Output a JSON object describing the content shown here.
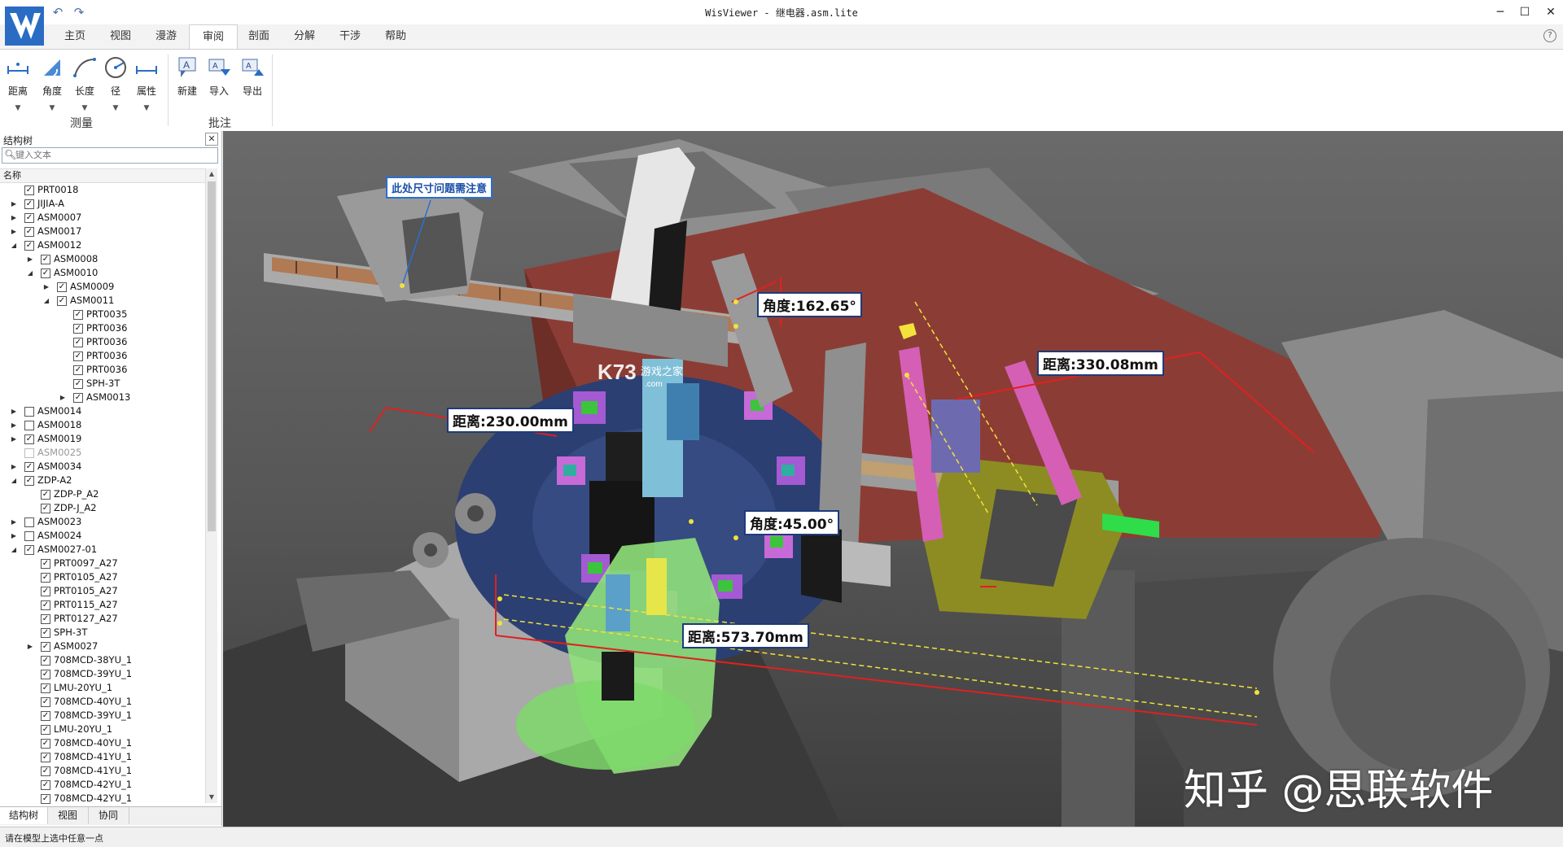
{
  "window": {
    "title": "WisViewer - 继电器.asm.lite"
  },
  "tabs": [
    {
      "label": "主页"
    },
    {
      "label": "视图"
    },
    {
      "label": "漫游"
    },
    {
      "label": "审阅",
      "active": true
    },
    {
      "label": "剖面"
    },
    {
      "label": "分解"
    },
    {
      "label": "干涉"
    },
    {
      "label": "帮助"
    }
  ],
  "ribbon": {
    "measure": {
      "group_label": "测量",
      "buttons": [
        {
          "label": "距离",
          "icon": "distance-icon"
        },
        {
          "label": "角度",
          "icon": "angle-icon"
        },
        {
          "label": "长度",
          "icon": "length-icon"
        },
        {
          "label": "径",
          "icon": "radius-icon"
        },
        {
          "label": "属性",
          "icon": "property-icon"
        }
      ]
    },
    "annotate": {
      "group_label": "批注",
      "buttons": [
        {
          "label": "新建",
          "icon": "new-annotation-icon"
        },
        {
          "label": "导入",
          "icon": "import-icon"
        },
        {
          "label": "导出",
          "icon": "export-icon"
        }
      ]
    }
  },
  "panel": {
    "title": "结构树",
    "search_placeholder": "键入文本",
    "column_header": "名称",
    "tabs": [
      "结构树",
      "视图",
      "协同"
    ]
  },
  "tree": [
    {
      "name": "PRT0018",
      "d": 1,
      "t": "",
      "c": "on"
    },
    {
      "name": "JIJIA-A",
      "d": 1,
      "t": "c",
      "c": "on"
    },
    {
      "name": "ASM0007",
      "d": 1,
      "t": "c",
      "c": "on"
    },
    {
      "name": "ASM0017",
      "d": 1,
      "t": "c",
      "c": "on"
    },
    {
      "name": "ASM0012",
      "d": 1,
      "t": "e",
      "c": "on"
    },
    {
      "name": "ASM0008",
      "d": 2,
      "t": "c",
      "c": "on"
    },
    {
      "name": "ASM0010",
      "d": 2,
      "t": "e",
      "c": "on"
    },
    {
      "name": "ASM0009",
      "d": 3,
      "t": "c",
      "c": "on"
    },
    {
      "name": "ASM0011",
      "d": 3,
      "t": "e",
      "c": "on"
    },
    {
      "name": "PRT0035",
      "d": 4,
      "t": "",
      "c": "on"
    },
    {
      "name": "PRT0036",
      "d": 4,
      "t": "",
      "c": "on"
    },
    {
      "name": "PRT0036",
      "d": 4,
      "t": "",
      "c": "on"
    },
    {
      "name": "PRT0036",
      "d": 4,
      "t": "",
      "c": "on"
    },
    {
      "name": "PRT0036",
      "d": 4,
      "t": "",
      "c": "on"
    },
    {
      "name": "SPH-3T",
      "d": 4,
      "t": "",
      "c": "on"
    },
    {
      "name": "ASM0013",
      "d": 4,
      "t": "c",
      "c": "on"
    },
    {
      "name": "ASM0014",
      "d": 1,
      "t": "c",
      "c": "off"
    },
    {
      "name": "ASM0018",
      "d": 1,
      "t": "c",
      "c": "off"
    },
    {
      "name": "ASM0019",
      "d": 1,
      "t": "c",
      "c": "on"
    },
    {
      "name": "ASM0025",
      "d": 1,
      "t": "",
      "c": "dis"
    },
    {
      "name": "ASM0034",
      "d": 1,
      "t": "c",
      "c": "on"
    },
    {
      "name": "ZDP-A2",
      "d": 1,
      "t": "e",
      "c": "on"
    },
    {
      "name": "ZDP-P_A2",
      "d": 2,
      "t": "",
      "c": "on"
    },
    {
      "name": "ZDP-J_A2",
      "d": 2,
      "t": "",
      "c": "on"
    },
    {
      "name": "ASM0023",
      "d": 1,
      "t": "c",
      "c": "off"
    },
    {
      "name": "ASM0024",
      "d": 1,
      "t": "c",
      "c": "off"
    },
    {
      "name": "ASM0027-01",
      "d": 1,
      "t": "e",
      "c": "on"
    },
    {
      "name": "PRT0097_A27",
      "d": 2,
      "t": "",
      "c": "on"
    },
    {
      "name": "PRT0105_A27",
      "d": 2,
      "t": "",
      "c": "on"
    },
    {
      "name": "PRT0105_A27",
      "d": 2,
      "t": "",
      "c": "on"
    },
    {
      "name": "PRT0115_A27",
      "d": 2,
      "t": "",
      "c": "on"
    },
    {
      "name": "PRT0127_A27",
      "d": 2,
      "t": "",
      "c": "on"
    },
    {
      "name": "SPH-3T",
      "d": 2,
      "t": "",
      "c": "on"
    },
    {
      "name": "ASM0027",
      "d": 2,
      "t": "c",
      "c": "on"
    },
    {
      "name": "708MCD-38YU_1",
      "d": 2,
      "t": "",
      "c": "on"
    },
    {
      "name": "708MCD-39YU_1",
      "d": 2,
      "t": "",
      "c": "on"
    },
    {
      "name": "LMU-20YU_1",
      "d": 2,
      "t": "",
      "c": "on"
    },
    {
      "name": "708MCD-40YU_1",
      "d": 2,
      "t": "",
      "c": "on"
    },
    {
      "name": "708MCD-39YU_1",
      "d": 2,
      "t": "",
      "c": "on"
    },
    {
      "name": "LMU-20YU_1",
      "d": 2,
      "t": "",
      "c": "on"
    },
    {
      "name": "708MCD-40YU_1",
      "d": 2,
      "t": "",
      "c": "on"
    },
    {
      "name": "708MCD-41YU_1",
      "d": 2,
      "t": "",
      "c": "on"
    },
    {
      "name": "708MCD-41YU_1",
      "d": 2,
      "t": "",
      "c": "on"
    },
    {
      "name": "708MCD-42YU_1",
      "d": 2,
      "t": "",
      "c": "on"
    },
    {
      "name": "708MCD-42YU_1",
      "d": 2,
      "t": "",
      "c": "on"
    }
  ],
  "viewport": {
    "annotations": {
      "note": "此处尺寸问题需注意",
      "angle1": "角度:162.65°",
      "dist1": "距离:330.08mm",
      "dist2": "距离:230.00mm",
      "angle2": "角度:45.00°",
      "dist3": "距离:573.70mm"
    },
    "watermark": "知乎 @思联软件",
    "k73": "K73",
    "k73_sub": "游戏之家",
    "k73_com": ".com"
  },
  "status": {
    "text": "请在模型上选中任意一点"
  }
}
